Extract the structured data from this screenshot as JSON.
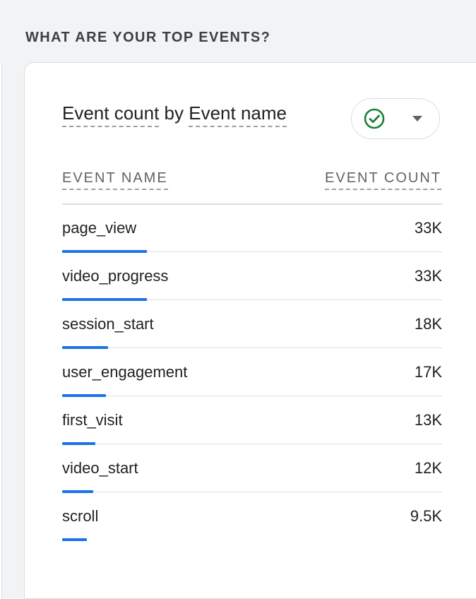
{
  "section": {
    "title": "WHAT ARE YOUR TOP EVENTS?"
  },
  "card": {
    "metric": "Event count",
    "by": "by",
    "dimension": "Event name",
    "compare_icon": "check-circle-icon",
    "menu_icon": "caret-down-icon"
  },
  "table": {
    "headers": [
      "EVENT NAME",
      "EVENT COUNT"
    ],
    "rows": [
      {
        "name": "page_view",
        "count": "33K",
        "share": 1.0
      },
      {
        "name": "video_progress",
        "count": "33K",
        "share": 1.0
      },
      {
        "name": "session_start",
        "count": "18K",
        "share": 0.545
      },
      {
        "name": "user_engagement",
        "count": "17K",
        "share": 0.515
      },
      {
        "name": "first_visit",
        "count": "13K",
        "share": 0.394
      },
      {
        "name": "video_start",
        "count": "12K",
        "share": 0.364
      },
      {
        "name": "scroll",
        "count": "9.5K",
        "share": 0.288
      }
    ]
  },
  "colors": {
    "accent": "#1a73e8",
    "success": "#188038"
  }
}
